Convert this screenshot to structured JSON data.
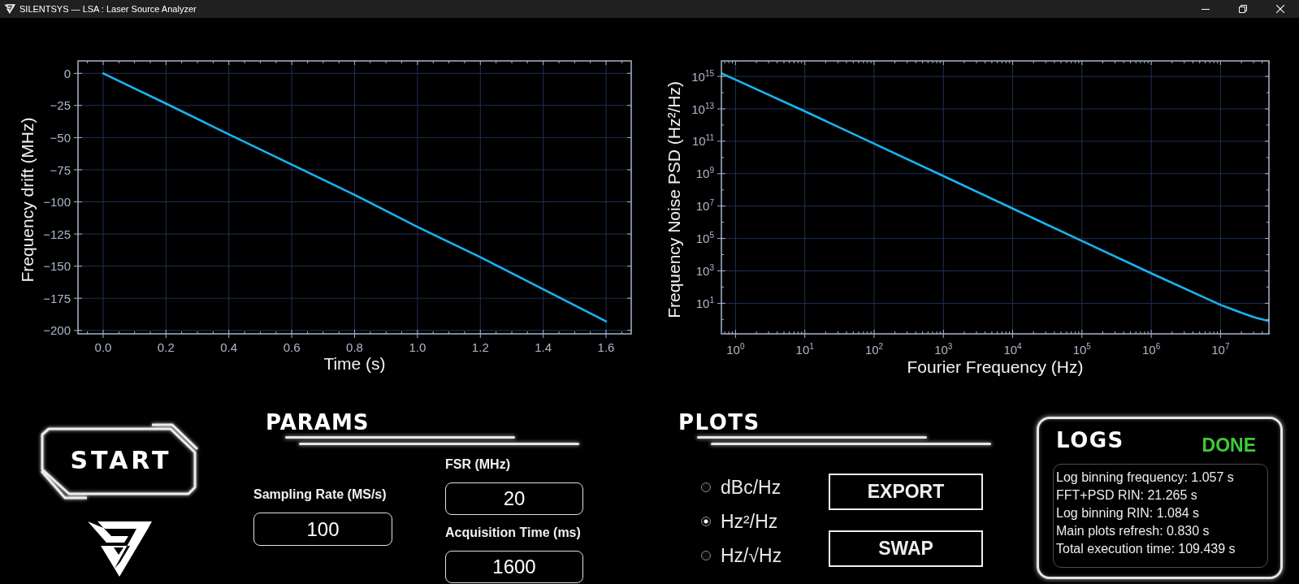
{
  "window": {
    "title": "SILENTSYS — LSA : Laser Source Analyzer"
  },
  "drift_plot": {
    "chart_data": {
      "type": "line",
      "xlabel": "Time (s)",
      "ylabel": "Frequency drift (MHz)",
      "grid": true,
      "x": [
        0,
        0.2,
        0.4,
        0.6,
        0.8,
        1.0,
        1.2,
        1.4,
        1.6
      ],
      "series": [
        {
          "color": "#18b4f2",
          "values": [
            0,
            -23.5,
            -47.5,
            -71,
            -94.5,
            -119.5,
            -143,
            -168,
            -193
          ]
        }
      ],
      "xlim": [
        -0.08,
        1.68
      ],
      "ylim": [
        -202.65,
        9.65
      ],
      "xticks": [
        {
          "value": 0,
          "label": "0.0"
        },
        {
          "value": 0.2,
          "label": "0.2"
        },
        {
          "value": 0.4,
          "label": "0.4"
        },
        {
          "value": 0.6,
          "label": "0.6"
        },
        {
          "value": 0.8,
          "label": "0.8"
        },
        {
          "value": 1.0,
          "label": "1.0"
        },
        {
          "value": 1.2,
          "label": "1.2"
        },
        {
          "value": 1.4,
          "label": "1.4"
        },
        {
          "value": 1.6,
          "label": "1.6"
        }
      ],
      "yticks": [
        {
          "value": 0,
          "label": "0"
        },
        {
          "value": -25,
          "label": "−25"
        },
        {
          "value": -50,
          "label": "−50"
        },
        {
          "value": -75,
          "label": "−75"
        },
        {
          "value": -100,
          "label": "−100"
        },
        {
          "value": -125,
          "label": "−125"
        },
        {
          "value": -150,
          "label": "−150"
        },
        {
          "value": -175,
          "label": "−175"
        },
        {
          "value": -200,
          "label": "−200"
        }
      ]
    }
  },
  "psd_plot": {
    "xlabel": "Fourier Frequency (Hz)",
    "ylabel": "Frequency Noise PSD (Hz²/Hz)",
    "x_tick_labels": [
      "10$^{0}$",
      "10$^{1}$",
      "10$^{2}$",
      "10$^{3}$",
      "10$^{4}$",
      "10$^{5}$",
      "10$^{6}$",
      "10$^{7}$"
    ],
    "y_tick_labels": [
      "10$^{15}$",
      "10$^{13}$",
      "10$^{11}$",
      "10$^{9}$",
      "10$^{7}$",
      "10$^{5}$",
      "10$^{3}$",
      "10$^{1}$"
    ]
  },
  "start_button": {
    "label": "START"
  },
  "params": {
    "heading": "PARAMS",
    "fields": [
      {
        "label": "Sampling Rate (MS/s)",
        "value": "100"
      },
      {
        "label": "FSR (MHz)",
        "value": "20"
      },
      {
        "label": "Acquisition Time (ms)",
        "value": "1600"
      }
    ]
  },
  "plots": {
    "heading": "PLOTS",
    "units": [
      {
        "label": "dBc/Hz",
        "selected": false
      },
      {
        "label": "Hz²/Hz",
        "selected": true
      },
      {
        "label": "Hz/√Hz",
        "selected": false
      }
    ],
    "buttons": [
      "EXPORT",
      "SWAP"
    ]
  },
  "logs": {
    "heading": "LOGS",
    "status": "DONE",
    "lines": [
      "Log binning frequency: 1.057 s",
      "FFT+PSD RIN: 21.265 s",
      "Log binning RIN: 1.084 s",
      "Main plots refresh: 0.830 s",
      "Total execution time: 109.439 s"
    ]
  }
}
